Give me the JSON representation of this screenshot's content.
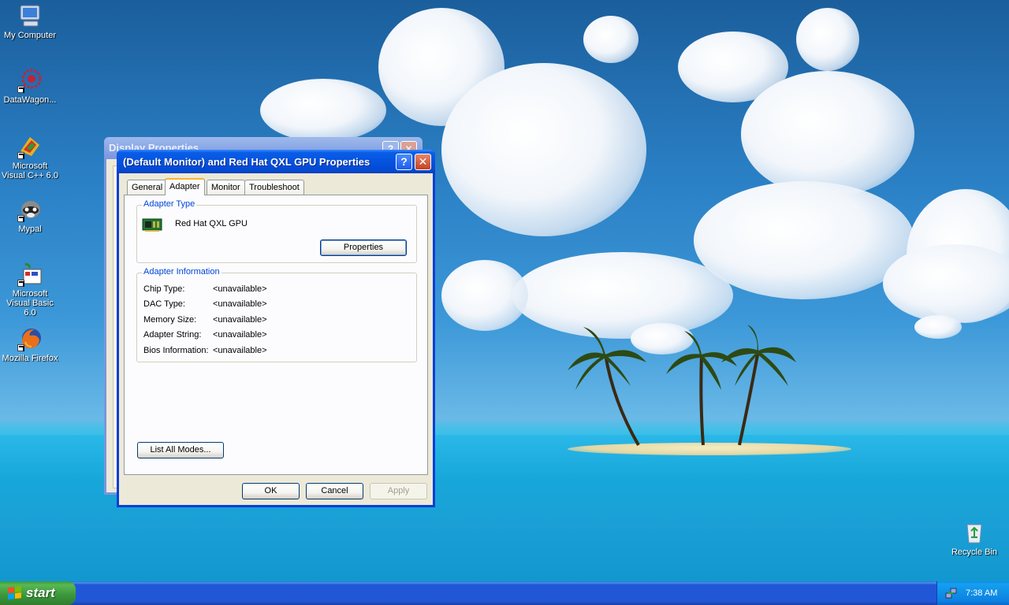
{
  "desktop": {
    "icons": [
      {
        "label": "My Computer",
        "icon": "my-computer-icon"
      },
      {
        "label": "DataWagon...",
        "icon": "datawagon-icon"
      },
      {
        "label": "Microsoft Visual C++ 6.0",
        "icon": "visual-cpp-icon"
      },
      {
        "label": "Mypal",
        "icon": "mypal-icon"
      },
      {
        "label": "Microsoft Visual Basic 6.0",
        "icon": "visual-basic-icon"
      },
      {
        "label": "Mozilla Firefox",
        "icon": "firefox-icon"
      },
      {
        "label": "Recycle Bin",
        "icon": "recycle-bin-icon"
      }
    ]
  },
  "background_window": {
    "title": "Display Properties"
  },
  "dialog": {
    "title": "(Default Monitor) and Red Hat QXL GPU Properties",
    "help_label": "?",
    "close_label": "✕",
    "tabs": [
      {
        "label": "General",
        "active": false
      },
      {
        "label": "Adapter",
        "active": true
      },
      {
        "label": "Monitor",
        "active": false
      },
      {
        "label": "Troubleshoot",
        "active": false
      }
    ],
    "adapter_type": {
      "legend": "Adapter Type",
      "name": "Red Hat QXL GPU",
      "properties_button": "Properties"
    },
    "adapter_info": {
      "legend": "Adapter Information",
      "rows": [
        {
          "label": "Chip Type:",
          "value": "<unavailable>"
        },
        {
          "label": "DAC Type:",
          "value": "<unavailable>"
        },
        {
          "label": "Memory Size:",
          "value": "<unavailable>"
        },
        {
          "label": "Adapter String:",
          "value": "<unavailable>"
        },
        {
          "label": "Bios Information:",
          "value": "<unavailable>"
        }
      ]
    },
    "list_modes_button": "List All Modes...",
    "buttons": {
      "ok": "OK",
      "cancel": "Cancel",
      "apply": "Apply"
    }
  },
  "taskbar": {
    "start_label": "start",
    "clock": "7:38 AM"
  },
  "colors": {
    "xp_title_blue": "#0553e0",
    "xp_legend_blue": "#0046d5",
    "dialog_face": "#ece9d8",
    "start_green": "#3b953b"
  }
}
